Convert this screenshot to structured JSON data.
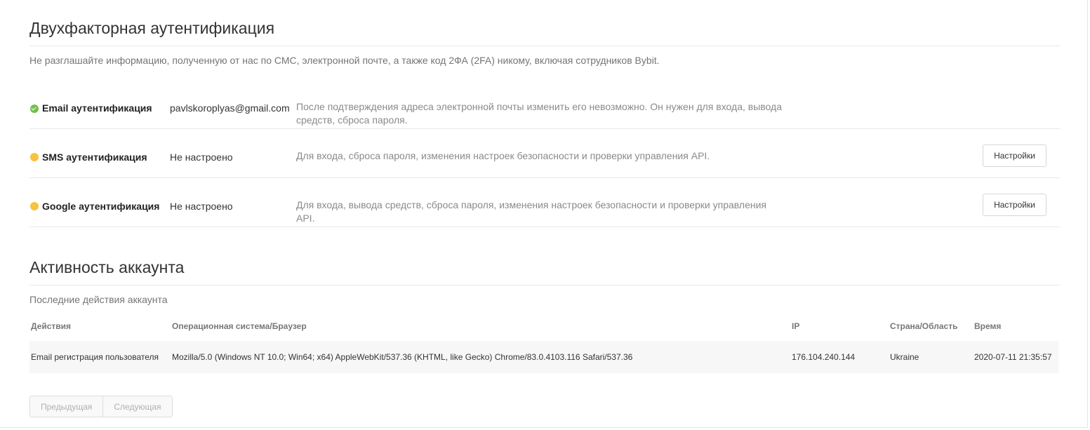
{
  "twofa": {
    "title": "Двухфакторная аутентификация",
    "notice": "Не разглашайте информацию, полученную от нас по СМС, электронной почте, а также код 2ФА (2FA) никому, включая сотрудников Bybit.",
    "rows": [
      {
        "name": "Email аутентификация",
        "value": "pavlskoroplyas@gmail.com",
        "desc": "После подтверждения адреса электронной почты изменить его невозможно. Он нужен для входа, вывода средств, сброса пароля.",
        "status": "verified"
      },
      {
        "name": "SMS аутентификация",
        "value": "Не настроено",
        "desc": "Для входа, сброса пароля, изменения настроек безопасности и проверки управления API.",
        "status": "not-configured",
        "button": "Настройки"
      },
      {
        "name": "Google аутентификация",
        "value": "Не настроено",
        "desc": "Для входа, вывода средств, сброса пароля, изменения настроек безопасности и проверки управления API.",
        "status": "not-configured",
        "button": "Настройки"
      }
    ],
    "status_colors": {
      "verified": "#72c14a",
      "not-configured": "#f7c23d"
    }
  },
  "activity": {
    "title": "Активность аккаунта",
    "subtitle": "Последние действия аккаунта",
    "columns": [
      "Действия",
      "Операционная система/Браузер",
      "IP",
      "Страна/Область",
      "Время"
    ],
    "rows": [
      [
        "Email регистрация пользователя",
        "Mozilla/5.0 (Windows NT 10.0; Win64; x64) AppleWebKit/537.36 (KHTML, like Gecko) Chrome/83.0.4103.116 Safari/537.36",
        "176.104.240.144",
        "Ukraine",
        "2020-07-11 21:35:57"
      ]
    ]
  },
  "pagination": {
    "prev": "Предыдущая",
    "next": "Следующая"
  }
}
